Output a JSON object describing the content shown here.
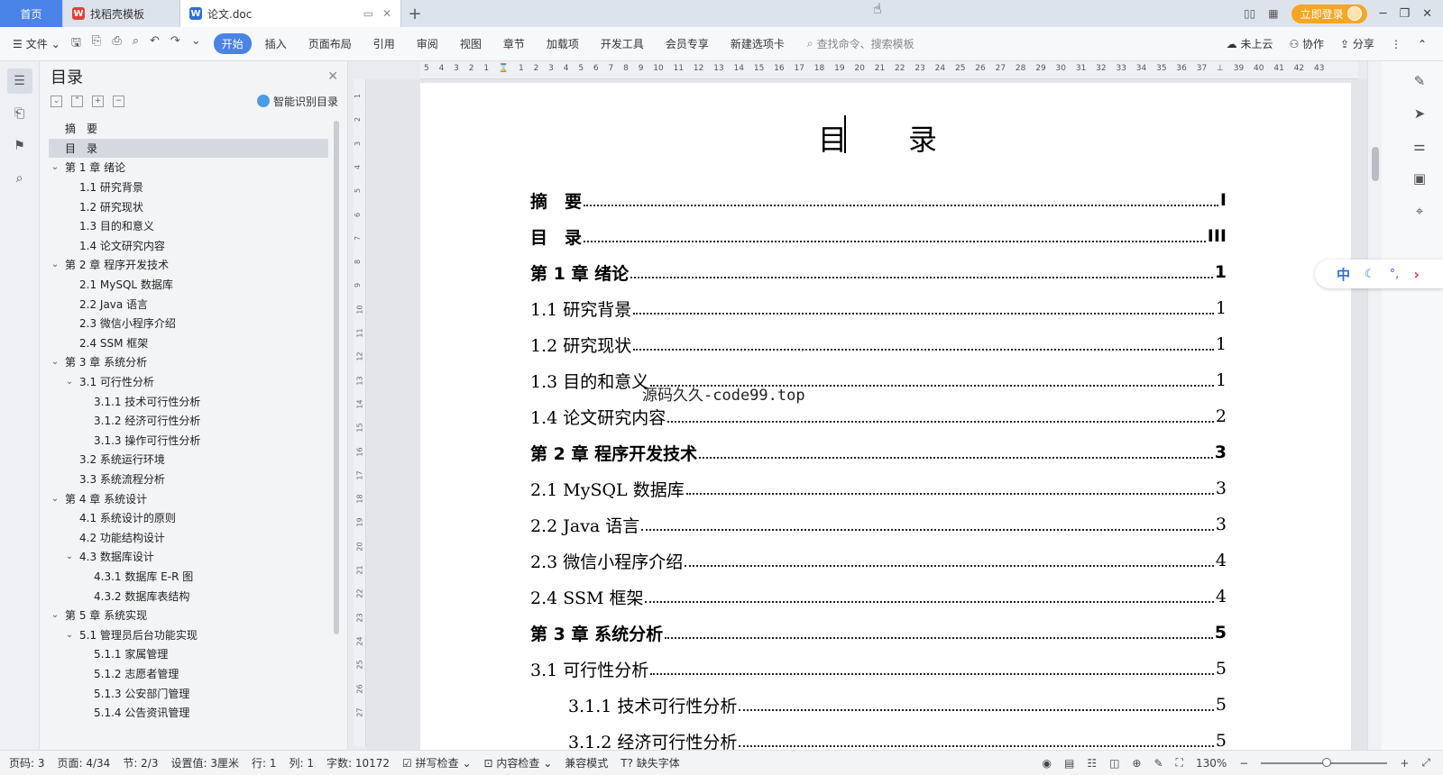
{
  "titlebar": {
    "tabs": [
      {
        "label": "首页"
      },
      {
        "label": "找稻壳模板"
      },
      {
        "label": "论文.doc"
      }
    ],
    "login_label": "立即登录"
  },
  "menubar": {
    "file_label": "文件",
    "items": [
      "开始",
      "插入",
      "页面布局",
      "引用",
      "审阅",
      "视图",
      "章节",
      "加载项",
      "开发工具",
      "会员专享",
      "新建选项卡"
    ],
    "active_item": "开始",
    "search_placeholder": "查找命令、搜索模板",
    "right": [
      "未上云",
      "协作",
      "分享"
    ]
  },
  "toc_panel": {
    "title": "目录",
    "smart_label": "智能识别目录",
    "items": [
      {
        "label": "摘　要",
        "level": 1,
        "expandable": false,
        "selected": false
      },
      {
        "label": "目　录",
        "level": 1,
        "expandable": false,
        "selected": true
      },
      {
        "label": "第 1 章  绪论",
        "level": 1,
        "expandable": true
      },
      {
        "label": "1.1  研究背景",
        "level": 2
      },
      {
        "label": "1.2  研究现状",
        "level": 2
      },
      {
        "label": "1.3  目的和意义",
        "level": 2
      },
      {
        "label": "1.4  论文研究内容",
        "level": 2
      },
      {
        "label": "第 2 章  程序开发技术",
        "level": 1,
        "expandable": true
      },
      {
        "label": "2.1 MySQL 数据库",
        "level": 2
      },
      {
        "label": "2.2 Java 语言",
        "level": 2
      },
      {
        "label": "2.3  微信小程序介绍",
        "level": 2
      },
      {
        "label": "2.4 SSM 框架",
        "level": 2
      },
      {
        "label": "第 3 章  系统分析",
        "level": 1,
        "expandable": true
      },
      {
        "label": "3.1 可行性分析",
        "level": 2,
        "expandable": true
      },
      {
        "label": "3.1.1 技术可行性分析",
        "level": 3
      },
      {
        "label": "3.1.2 经济可行性分析",
        "level": 3
      },
      {
        "label": "3.1.3 操作可行性分析",
        "level": 3
      },
      {
        "label": "3.2 系统运行环境",
        "level": 2
      },
      {
        "label": "3.3 系统流程分析",
        "level": 2
      },
      {
        "label": "第 4 章  系统设计",
        "level": 1,
        "expandable": true
      },
      {
        "label": "4.1  系统设计的原则",
        "level": 2
      },
      {
        "label": "4.2  功能结构设计",
        "level": 2
      },
      {
        "label": "4.3  数据库设计",
        "level": 2,
        "expandable": true
      },
      {
        "label": "4.3.1  数据库 E-R 图",
        "level": 3
      },
      {
        "label": "4.3.2  数据库表结构",
        "level": 3
      },
      {
        "label": "第 5 章  系统实现",
        "level": 1,
        "expandable": true
      },
      {
        "label": "5.1 管理员后台功能实现",
        "level": 2,
        "expandable": true
      },
      {
        "label": "5.1.1  家属管理",
        "level": 3
      },
      {
        "label": "5.1.2  志愿者管理",
        "level": 3
      },
      {
        "label": "5.1.3  公安部门管理",
        "level": 3
      },
      {
        "label": "5.1.4  公告资讯管理",
        "level": 3
      }
    ]
  },
  "document": {
    "title": "目　录",
    "watermark": "源码久久-code99.top",
    "entries": [
      {
        "text": "摘　要",
        "page": "I",
        "style": "bold"
      },
      {
        "text": "目　录",
        "page": "III",
        "style": "bold"
      },
      {
        "text": "第 1 章  绪论",
        "page": "1",
        "style": "bold"
      },
      {
        "text": "1.1  研究背景",
        "page": "1",
        "style": "normal"
      },
      {
        "text": "1.2  研究现状",
        "page": "1",
        "style": "normal"
      },
      {
        "text": "1.3  目的和意义",
        "page": "1",
        "style": "normal"
      },
      {
        "text": "1.4  论文研究内容",
        "page": "2",
        "style": "normal"
      },
      {
        "text": "第 2 章  程序开发技术",
        "page": "3",
        "style": "bold"
      },
      {
        "text": "2.1 MySQL 数据库",
        "page": "3",
        "style": "normal"
      },
      {
        "text": "2.2 Java 语言",
        "page": "3",
        "style": "normal"
      },
      {
        "text": "2.3  微信小程序介绍",
        "page": "4",
        "style": "normal"
      },
      {
        "text": "2.4 SSM 框架",
        "page": "4",
        "style": "normal"
      },
      {
        "text": "第 3 章  系统分析",
        "page": "5",
        "style": "bold"
      },
      {
        "text": "3.1 可行性分析",
        "page": "5",
        "style": "normal"
      },
      {
        "text": "3.1.1 技术可行性分析",
        "page": "5",
        "style": "indent"
      },
      {
        "text": "3.1.2 经济可行性分析",
        "page": "5",
        "style": "indent"
      }
    ]
  },
  "ime": {
    "lang": "中"
  },
  "status": {
    "page_num": "页码: 3",
    "page_of": "页面: 4/34",
    "section": "节: 2/3",
    "setting": "设置值: 3厘米",
    "row": "行: 1",
    "col": "列: 1",
    "words": "字数: 10172",
    "spell": "拼写检查",
    "content_check": "内容检查",
    "compat": "兼容模式",
    "missing_font": "缺失字体",
    "zoom": "130%"
  },
  "colors": {
    "accent": "#4a83e7",
    "login": "#f5a623"
  }
}
